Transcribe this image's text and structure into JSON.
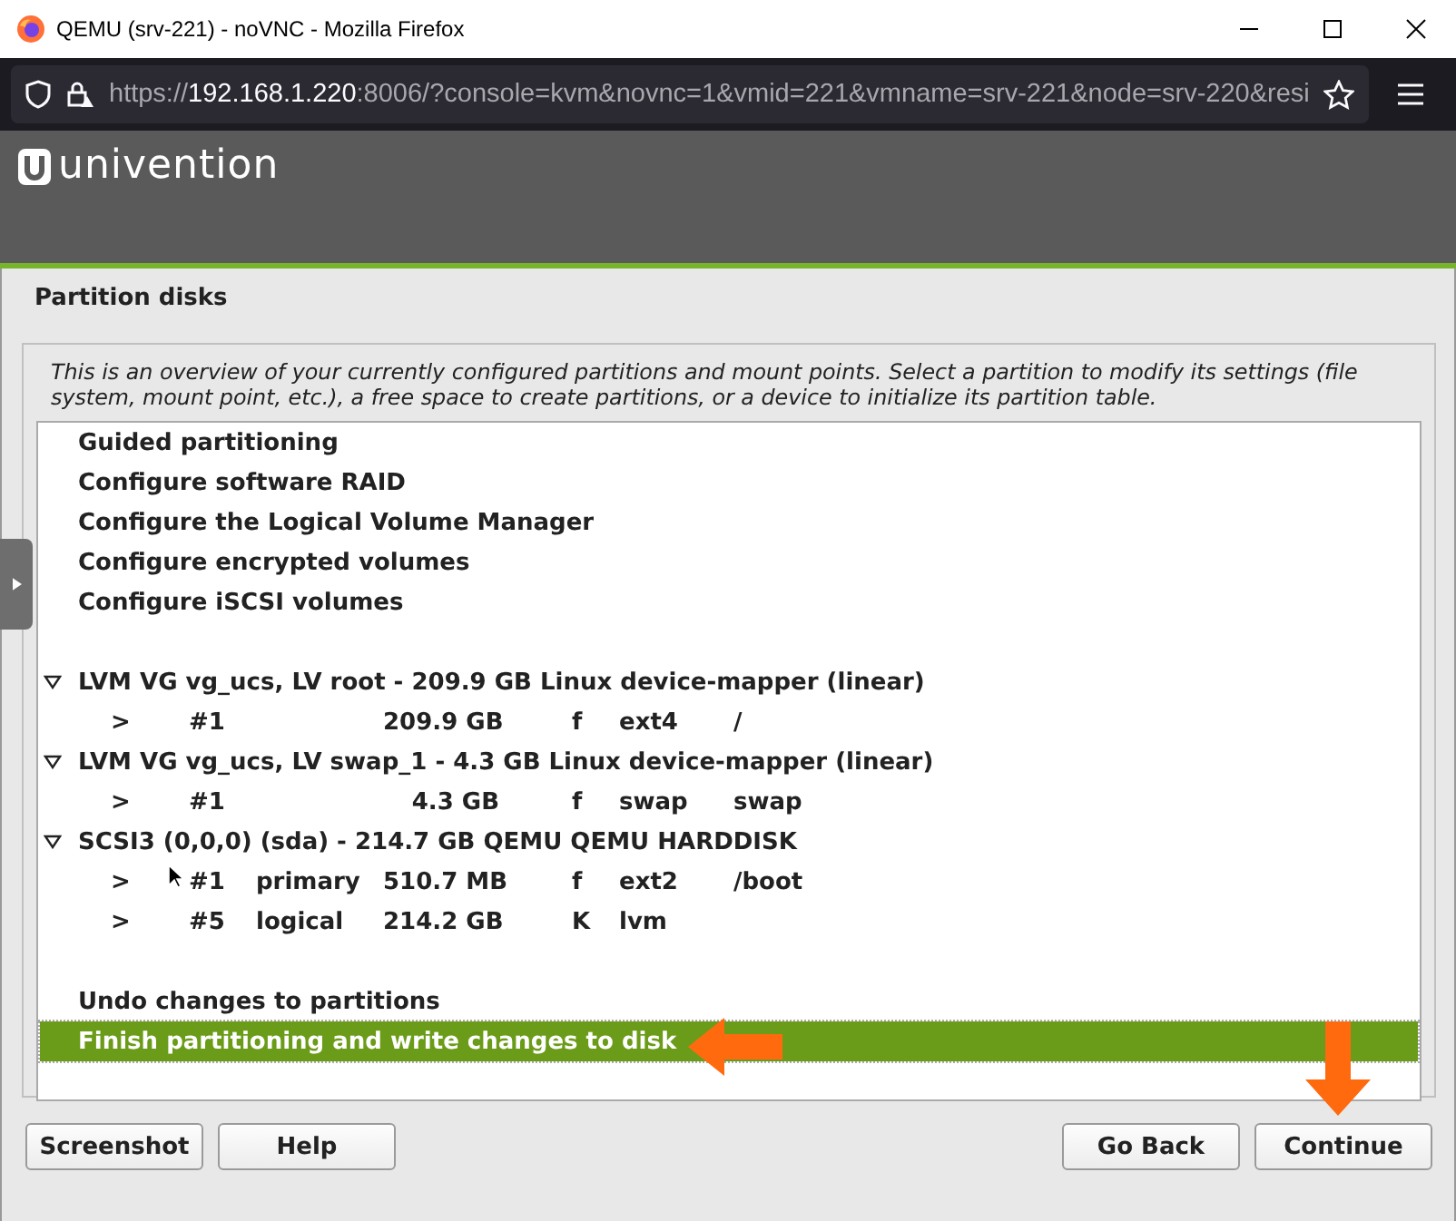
{
  "window": {
    "title": "QEMU (srv-221) - noVNC - Mozilla Firefox"
  },
  "address_bar": {
    "scheme": "https://",
    "host": "192.168.1.220",
    "rest": ":8006/?console=kvm&novnc=1&vmid=221&vmname=srv-221&node=srv-220&resi"
  },
  "header": {
    "logo": "univention"
  },
  "installer": {
    "title": "Partition disks",
    "description": "This is an overview of your currently configured partitions and mount points. Select a partition to modify its settings (file system, mount point, etc.), a free space to create partitions, or a device to initialize its partition table.",
    "items": [
      {
        "kind": "action",
        "label": "Guided partitioning",
        "selected": false
      },
      {
        "kind": "action",
        "label": "Configure software RAID",
        "selected": false
      },
      {
        "kind": "action",
        "label": "Configure the Logical Volume Manager",
        "selected": false
      },
      {
        "kind": "action",
        "label": "Configure encrypted volumes",
        "selected": false
      },
      {
        "kind": "action",
        "label": "Configure iSCSI volumes",
        "selected": false
      },
      {
        "kind": "blank"
      },
      {
        "kind": "device",
        "label": "LVM VG vg_ucs, LV root - 209.9 GB Linux device-mapper (linear)",
        "expanded": true,
        "selected": false
      },
      {
        "kind": "partition",
        "marker": ">",
        "number": "#1",
        "size": "209.9 GB",
        "flag": "f",
        "filesystem": "ext4",
        "mount": "/",
        "selected": false
      },
      {
        "kind": "device",
        "label": "LVM VG vg_ucs, LV swap_1 - 4.3 GB Linux device-mapper (linear)",
        "expanded": true,
        "selected": false
      },
      {
        "kind": "partition",
        "marker": ">",
        "number": "#1",
        "size": "4.3 GB",
        "flag": "f",
        "filesystem": "swap",
        "mount": "swap",
        "selected": false
      },
      {
        "kind": "device",
        "label": "SCSI3 (0,0,0) (sda) - 214.7 GB QEMU QEMU HARDDISK",
        "expanded": true,
        "selected": false
      },
      {
        "kind": "partition",
        "marker": ">",
        "number": "#1",
        "type": "primary",
        "size": "510.7 MB",
        "flag": "f",
        "filesystem": "ext2",
        "mount": "/boot",
        "selected": false
      },
      {
        "kind": "partition",
        "marker": ">",
        "number": "#5",
        "type": "logical",
        "size": "214.2 GB",
        "flag": "K",
        "filesystem": "lvm",
        "selected": false
      },
      {
        "kind": "blank"
      },
      {
        "kind": "action",
        "label": "Undo changes to partitions",
        "selected": false
      },
      {
        "kind": "action",
        "label": "Finish partitioning and write changes to disk",
        "selected": true
      }
    ],
    "buttons_left": [
      "Screenshot",
      "Help"
    ],
    "buttons_right": [
      "Go Back",
      "Continue"
    ]
  }
}
